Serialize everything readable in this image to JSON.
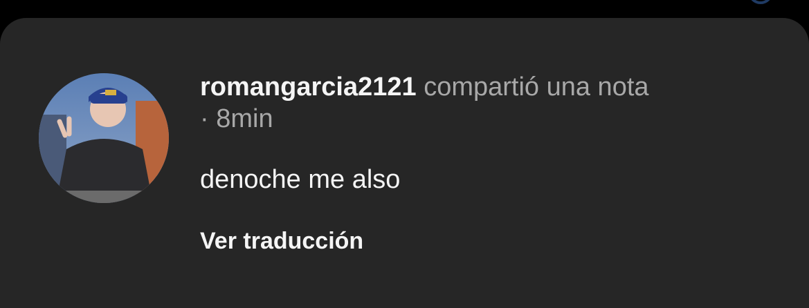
{
  "note": {
    "username": "romangarcia2121",
    "action_text": " compartió una nota",
    "time_text": "· 8min",
    "body_text": "denoche me also",
    "translate_label": "Ver traducción"
  },
  "colors": {
    "sheet_background": "#262626",
    "primary_text": "#f5f5f5",
    "secondary_text": "#a8a8a8"
  },
  "icons": {
    "avatar": "user-avatar-photo"
  }
}
